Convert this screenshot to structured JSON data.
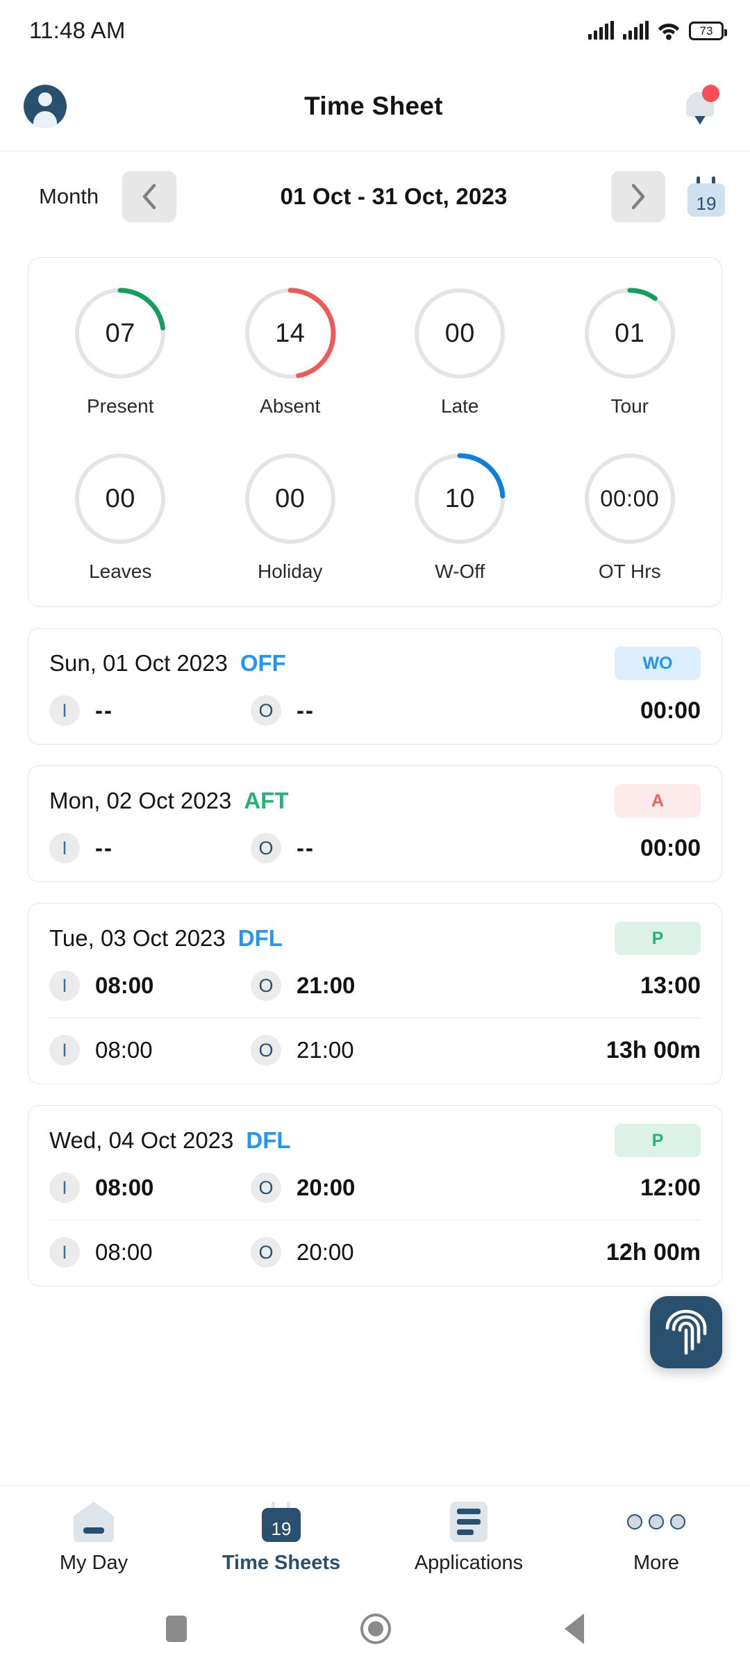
{
  "status_bar": {
    "time": "11:48 AM",
    "battery_level": "73",
    "signal_icon": "signal-bars-icon",
    "wifi_icon": "wifi-icon",
    "battery_icon": "battery-icon"
  },
  "app_bar": {
    "title": "Time Sheet",
    "avatar_icon": "user-avatar-icon",
    "notification_icon": "bell-icon",
    "has_notification_dot": true
  },
  "month_nav": {
    "label": "Month",
    "prev_icon": "chevron-left-icon",
    "next_icon": "chevron-right-icon",
    "range": "01 Oct - 31 Oct, 2023",
    "calendar_icon": "calendar-icon",
    "calendar_day": "19"
  },
  "summary": {
    "rows": [
      [
        {
          "value": "07",
          "label": "Present",
          "color": "#13a05c",
          "percent": 23
        },
        {
          "value": "14",
          "label": "Absent",
          "color": "#ee5a5a",
          "percent": 47
        },
        {
          "value": "00",
          "label": "Late",
          "color": "#13a05c",
          "percent": 0
        },
        {
          "value": "01",
          "label": "Tour",
          "color": "#13a05c",
          "percent": 10
        }
      ],
      [
        {
          "value": "00",
          "label": "Leaves",
          "color": "#13a05c",
          "percent": 0
        },
        {
          "value": "00",
          "label": "Holiday",
          "color": "#13a05c",
          "percent": 0
        },
        {
          "value": "10",
          "label": "W-Off",
          "color": "#0d7fe0",
          "percent": 24
        },
        {
          "value": "00:00",
          "label": "OT Hrs",
          "color": "#0d7fe0",
          "percent": 0
        }
      ]
    ]
  },
  "days": [
    {
      "date": "Sun, 01 Oct 2023",
      "shift": "OFF",
      "shift_color": "#2196f3",
      "badge": "WO",
      "badge_color": "#2196f3",
      "badge_bg": "#ddeeff",
      "rows": [
        {
          "in_label": "I",
          "in_time": "--",
          "out_label": "O",
          "out_time": "--",
          "total": "00:00",
          "bold": true,
          "dash": true
        }
      ]
    },
    {
      "date": "Mon, 02 Oct 2023",
      "shift": "AFT",
      "shift_color": "#21b573",
      "badge": "A",
      "badge_color": "#f0615f",
      "badge_bg": "#fdeaea",
      "rows": [
        {
          "in_label": "I",
          "in_time": "--",
          "out_label": "O",
          "out_time": "--",
          "total": "00:00",
          "bold": true,
          "dash": true
        }
      ]
    },
    {
      "date": "Tue, 03 Oct 2023",
      "shift": "DFL",
      "shift_color": "#2196f3",
      "badge": "P",
      "badge_color": "#21b573",
      "badge_bg": "#dcf2e6",
      "rows": [
        {
          "in_label": "I",
          "in_time": "08:00",
          "out_label": "O",
          "out_time": "21:00",
          "total": "13:00",
          "bold": true,
          "dash": false
        },
        {
          "in_label": "I",
          "in_time": "08:00",
          "out_label": "O",
          "out_time": "21:00",
          "total": "13h 00m",
          "bold": false,
          "dash": false
        }
      ]
    },
    {
      "date": "Wed, 04 Oct 2023",
      "shift": "DFL",
      "shift_color": "#2196f3",
      "badge": "P",
      "badge_color": "#21b573",
      "badge_bg": "#dcf2e6",
      "rows": [
        {
          "in_label": "I",
          "in_time": "08:00",
          "out_label": "O",
          "out_time": "20:00",
          "total": "12:00",
          "bold": true,
          "dash": false
        },
        {
          "in_label": "I",
          "in_time": "08:00",
          "out_label": "O",
          "out_time": "20:00",
          "total": "12h 00m",
          "bold": false,
          "dash": false
        }
      ]
    }
  ],
  "fab": {
    "icon": "fingerprint-icon",
    "color": "#2a5070"
  },
  "bottom_nav": {
    "items": [
      {
        "label": "My Day",
        "icon": "home-icon",
        "active": false
      },
      {
        "label": "Time Sheets",
        "icon": "calendar-icon",
        "active": true,
        "day": "19"
      },
      {
        "label": "Applications",
        "icon": "list-icon",
        "active": false
      },
      {
        "label": "More",
        "icon": "more-dots-icon",
        "active": false
      }
    ]
  },
  "system_nav": {
    "recents_icon": "square-icon",
    "home_icon": "circle-icon",
    "back_icon": "triangle-back-icon"
  }
}
